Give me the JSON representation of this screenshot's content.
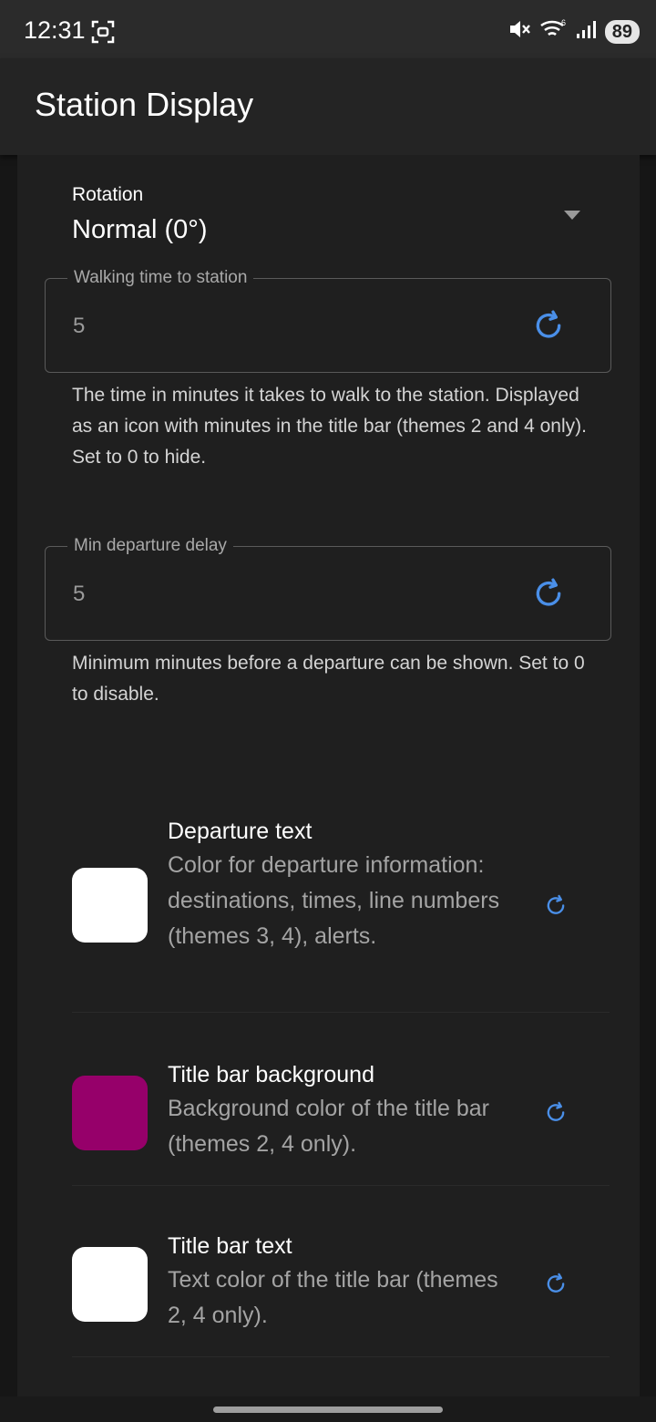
{
  "status_bar": {
    "time": "12:31",
    "battery": "89",
    "icons": [
      "screenshot-icon",
      "mute-icon",
      "wifi-icon",
      "signal-icon",
      "battery-icon"
    ]
  },
  "app_bar": {
    "title": "Station Display"
  },
  "rotation": {
    "label": "Rotation",
    "value": "Normal (0°)"
  },
  "walking_time": {
    "label": "Walking time to station",
    "value": "5",
    "helper": "The time in minutes it takes to walk to the station. Displayed as an icon with minutes in the title bar (themes 2 and 4 only). Set to 0 to hide."
  },
  "min_delay": {
    "label": "Min departure delay",
    "value": "5",
    "helper": "Minimum minutes before a departure can be shown. Set to 0 to disable."
  },
  "colors": [
    {
      "title": "Departure text",
      "description": "Color for departure information: destinations, times, line numbers (themes 3, 4), alerts.",
      "swatch": "#ffffff"
    },
    {
      "title": "Title bar background",
      "description": "Background color of the title bar (themes 2, 4 only).",
      "swatch": "#96006a"
    },
    {
      "title": "Title bar text",
      "description": "Text color of the title bar (themes 2, 4 only).",
      "swatch": "#ffffff"
    }
  ],
  "theme": {
    "accent": "#4a8fe8",
    "background": "#1f1f1f"
  }
}
